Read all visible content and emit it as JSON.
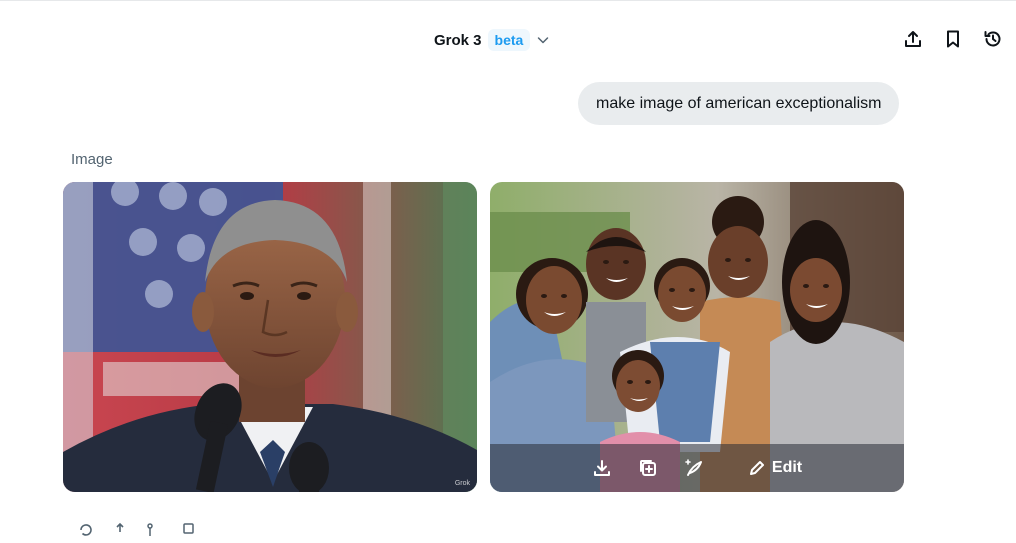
{
  "header": {
    "model_name": "Grok 3",
    "badge": "beta",
    "actions": [
      "share-icon",
      "bookmark-icon",
      "history-icon"
    ]
  },
  "conversation": {
    "user_message": "make image of american exceptionalism",
    "response_label": "Image"
  },
  "images": [
    {
      "subject": "man speaking at microphones before an American flag",
      "watermark": "Grok"
    },
    {
      "subject": "smiling family group outdoors"
    }
  ],
  "image_overlay": {
    "actions": [
      "download-icon",
      "add-image-icon",
      "magic-quill-icon"
    ],
    "edit_label": "Edit"
  },
  "colors": {
    "accent": "#1d9bf0",
    "bubble": "#e9ecee",
    "muted_text": "#536471"
  }
}
